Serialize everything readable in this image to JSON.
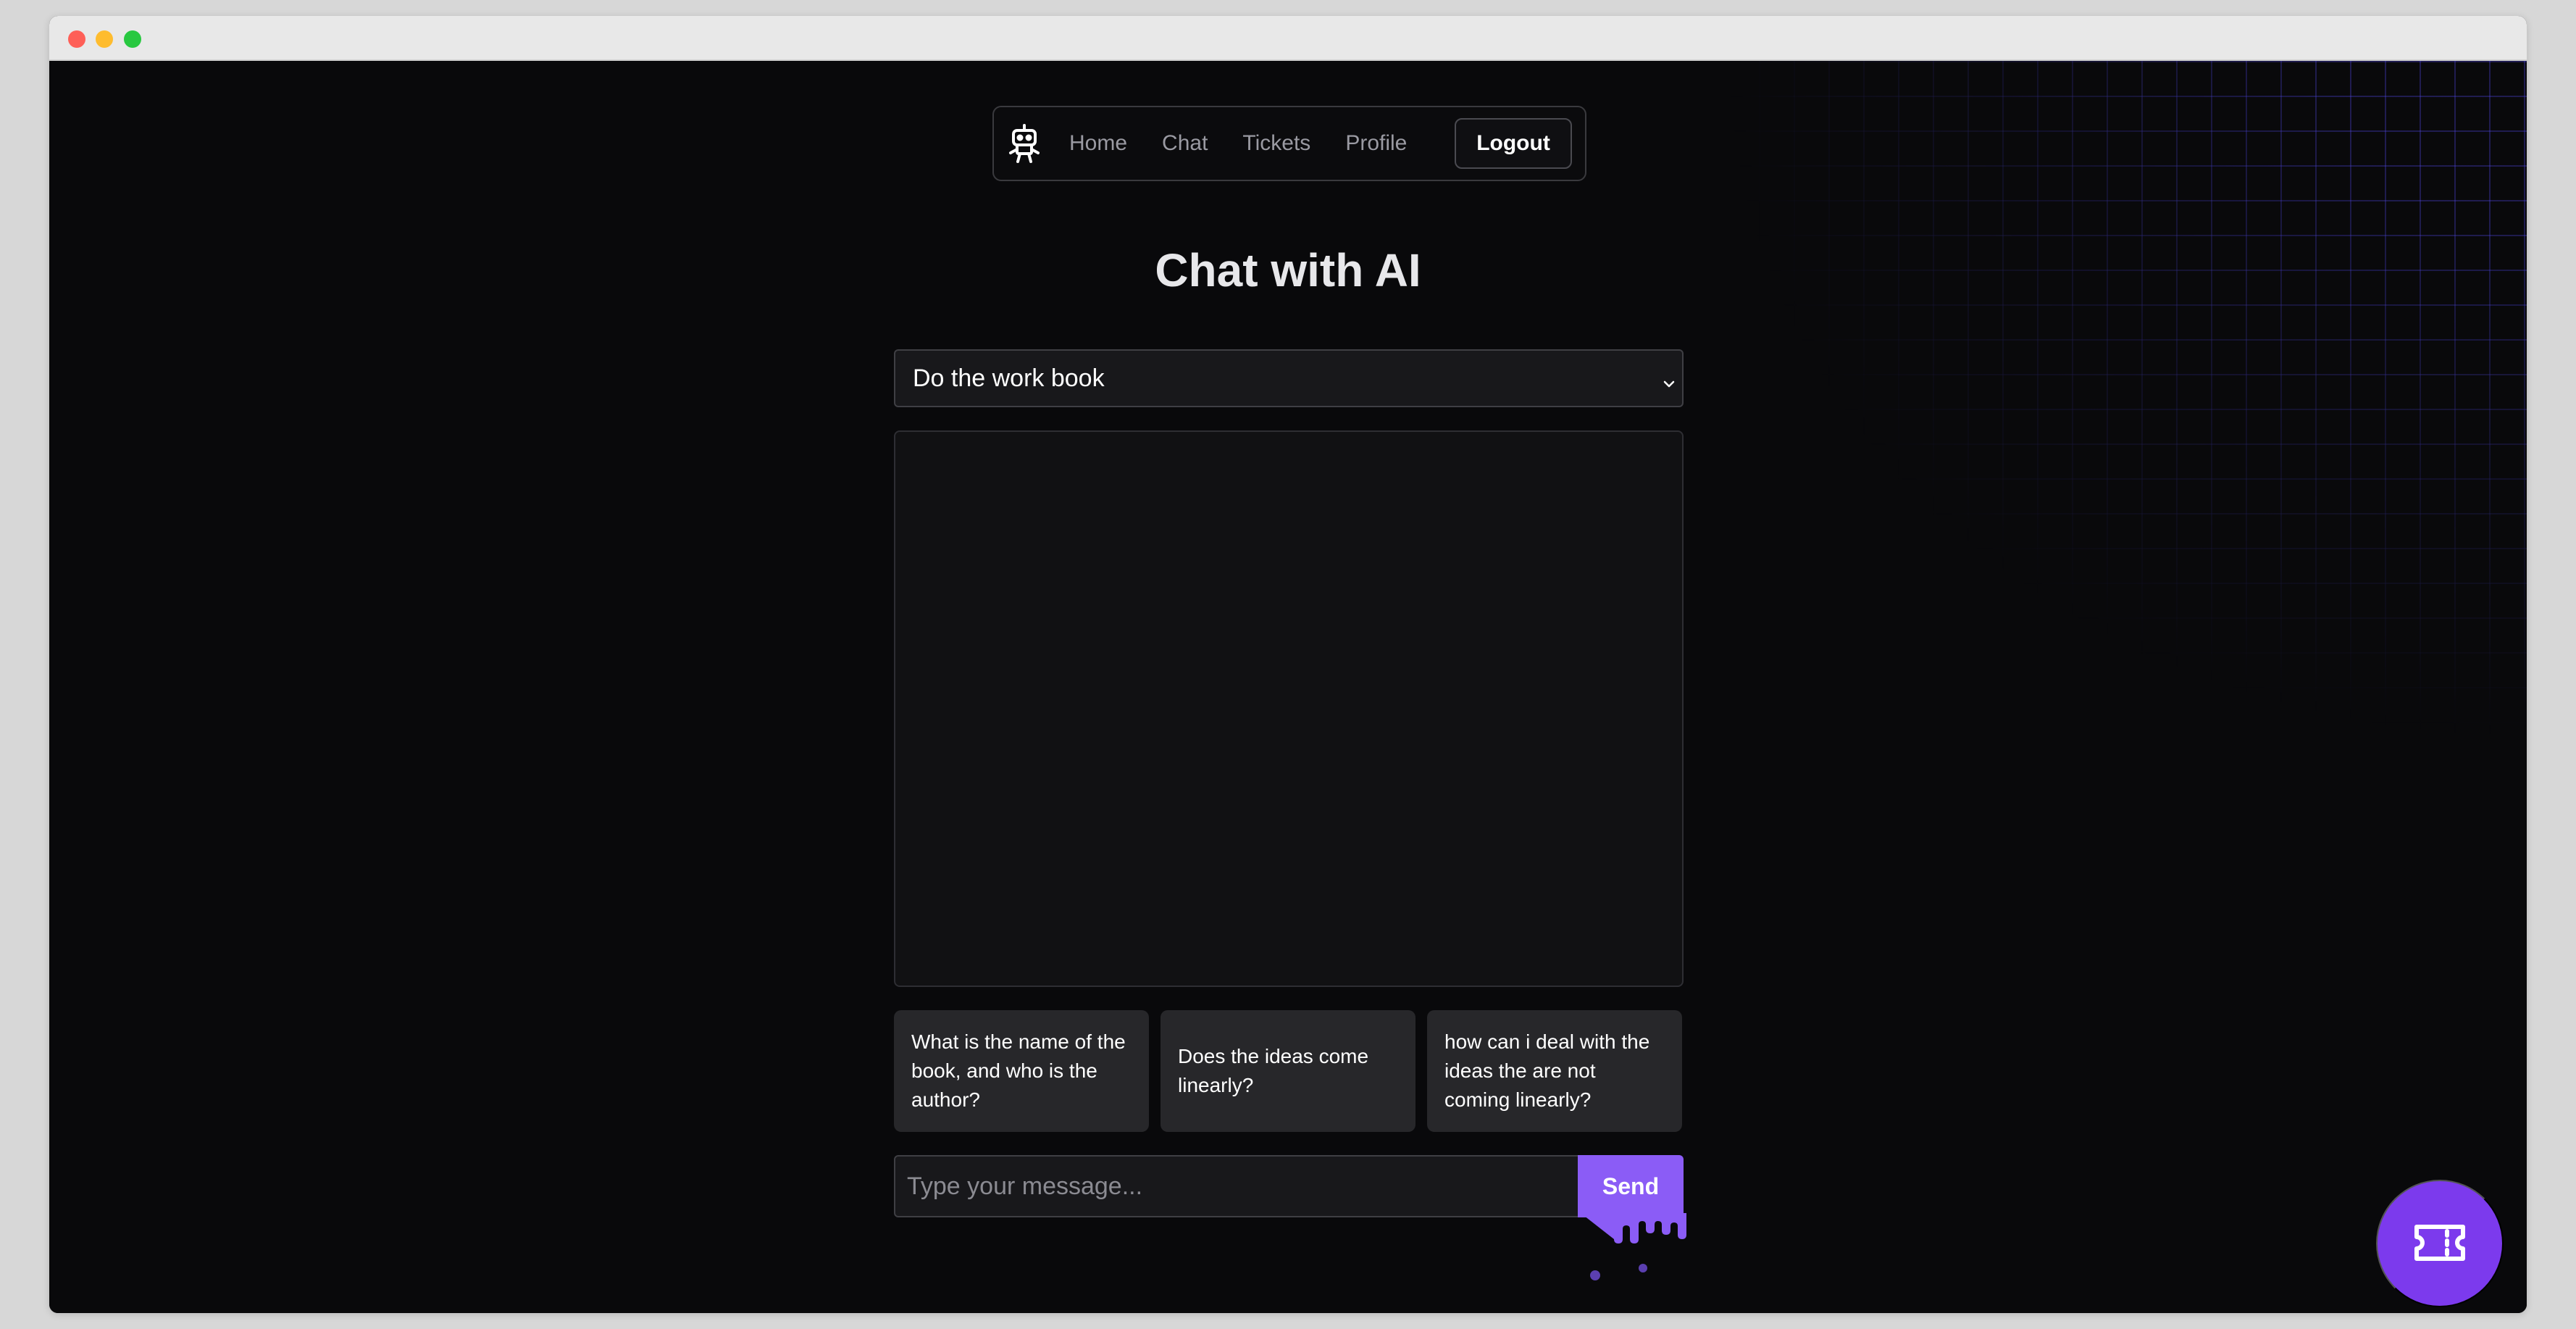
{
  "nav": {
    "logo_icon": "robot-icon",
    "links": [
      "Home",
      "Chat",
      "Tickets",
      "Profile"
    ],
    "logout_label": "Logout"
  },
  "page": {
    "title": "Chat with AI"
  },
  "book_select": {
    "selected": "Do the work book"
  },
  "suggestions": [
    "What is the name of the book, and who is the author?",
    "Does the ideas come linearly?",
    "how can i deal with the ideas the are not coming linearly?"
  ],
  "composer": {
    "placeholder": "Type your message...",
    "send_label": "Send"
  },
  "fab": {
    "icon": "ticket-icon"
  },
  "colors": {
    "accent": "#8b5cf6",
    "fab": "#7c3aed",
    "background": "#09090b"
  }
}
